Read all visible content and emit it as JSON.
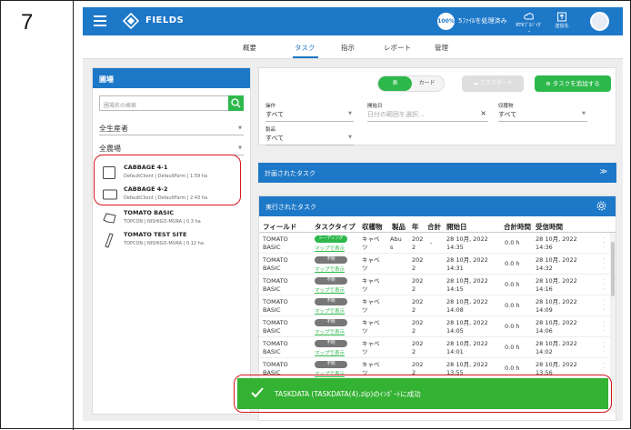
{
  "step": "7",
  "topbar": {
    "brand": "FIELDS",
    "progress_badge": "100%",
    "processing_status": "5ﾌｧｲﾙを処理済み",
    "icon1_label": "RTKﾌﾟﾛﾊﾞｲﾀﾞｰ",
    "icon2_label": "送信先"
  },
  "nav": {
    "tabs": [
      "概要",
      "タスク",
      "指示",
      "レポート",
      "管理"
    ],
    "active": "タスク"
  },
  "left": {
    "title": "圃場",
    "search_placeholder": "圃場名の検索",
    "filter_grower": "全生産者",
    "filter_farm": "全農場",
    "fields": [
      {
        "name": "CABBAGE 4-1",
        "sub": "DefaultClient | DefaultFarm | 1.59 ha"
      },
      {
        "name": "CABBAGE 4-2",
        "sub": "DefaultClient | DefaultFarm | 2.43 ha"
      },
      {
        "name": "TOMATO BASIC",
        "sub": "TOPCON | NISHIGO-MURA | 0.3 ha"
      },
      {
        "name": "TOMATO TEST SITE",
        "sub": "TOPCON | NISHIGO-MURA | 0.12 ha"
      }
    ]
  },
  "filters": {
    "view_table": "表",
    "view_card": "カード",
    "export": "エクスポート",
    "add_task": "タスクを追加する",
    "operation_label": "操作",
    "operation_value": "すべて",
    "start_label": "開始日",
    "start_placeholder": "日付の範囲を選択...",
    "crop_label": "収穫物",
    "crop_value": "すべて",
    "product_label": "製品",
    "product_value": "すべて"
  },
  "planned": {
    "title": "計画されたタスク"
  },
  "executed": {
    "title": "実行されたタスク",
    "columns": [
      "フィールド",
      "タスクタイプ",
      "収穫物",
      "製品",
      "年",
      "合計",
      "開始日",
      "合計時間",
      "受信時間"
    ],
    "rows": [
      {
        "field": [
          "TOMATO",
          "BASIC"
        ],
        "type": "シーディング",
        "type_color": "#2db84c",
        "map": "マップで表示",
        "crop": [
          "キャベ",
          "ツ"
        ],
        "product": [
          "Abu",
          "s"
        ],
        "year": [
          "202",
          "2"
        ],
        "total": "-",
        "start": [
          "28 10月, 2022",
          "14:35"
        ],
        "duration": "0.0 h",
        "received": [
          "28 10月, 2022",
          "14:36"
        ]
      },
      {
        "field": [
          "TOMATO",
          "BASIC"
        ],
        "type": "不明",
        "type_color": "#777777",
        "map": "マップで表示",
        "crop": [
          "キャベ",
          "ツ"
        ],
        "product": [
          "",
          ""
        ],
        "year": [
          "202",
          "2"
        ],
        "total": "",
        "start": [
          "28 10月, 2022",
          "14:31"
        ],
        "duration": "0.0 h",
        "received": [
          "28 10月, 2022",
          "14:32"
        ]
      },
      {
        "field": [
          "TOMATO",
          "BASIC"
        ],
        "type": "不明",
        "type_color": "#777777",
        "map": "マップで表示",
        "crop": [
          "キャベ",
          "ツ"
        ],
        "product": [
          "",
          ""
        ],
        "year": [
          "202",
          "2"
        ],
        "total": "",
        "start": [
          "28 10月, 2022",
          "14:15"
        ],
        "duration": "0.0 h",
        "received": [
          "28 10月, 2022",
          "14:16"
        ]
      },
      {
        "field": [
          "TOMATO",
          "BASIC"
        ],
        "type": "不明",
        "type_color": "#777777",
        "map": "マップで表示",
        "crop": [
          "キャベ",
          "ツ"
        ],
        "product": [
          "",
          ""
        ],
        "year": [
          "202",
          "2"
        ],
        "total": "",
        "start": [
          "28 10月, 2022",
          "14:08"
        ],
        "duration": "0.0 h",
        "received": [
          "28 10月, 2022",
          "14:09"
        ]
      },
      {
        "field": [
          "TOMATO",
          "BASIC"
        ],
        "type": "不明",
        "type_color": "#777777",
        "map": "マップで表示",
        "crop": [
          "キャベ",
          "ツ"
        ],
        "product": [
          "",
          ""
        ],
        "year": [
          "202",
          "2"
        ],
        "total": "",
        "start": [
          "28 10月, 2022",
          "14:05"
        ],
        "duration": "0.0 h",
        "received": [
          "28 10月, 2022",
          "14:06"
        ]
      },
      {
        "field": [
          "TOMATO",
          "BASIC"
        ],
        "type": "不明",
        "type_color": "#777777",
        "map": "マップで表示",
        "crop": [
          "キャベ",
          "ツ"
        ],
        "product": [
          "",
          ""
        ],
        "year": [
          "202",
          "2"
        ],
        "total": "",
        "start": [
          "28 10月, 2022",
          "14:01"
        ],
        "duration": "0.0 h",
        "received": [
          "28 10月, 2022",
          "14:02"
        ]
      },
      {
        "field": [
          "TOMATO",
          "BASIC"
        ],
        "type": "不明",
        "type_color": "#777777",
        "map": "マップで表示",
        "crop": [
          "キャベ",
          "ツ"
        ],
        "product": [
          "",
          ""
        ],
        "year": [
          "202",
          "2"
        ],
        "total": "",
        "start": [
          "28 10月, 2022",
          "13:55"
        ],
        "duration": "0.0 h",
        "received": [
          "28 10月, 2022",
          "13:56"
        ]
      }
    ]
  },
  "toast": {
    "message": "TASKDATA (TASKDATA(4).zip)のｲﾝﾎﾟｰﾄに成功"
  }
}
